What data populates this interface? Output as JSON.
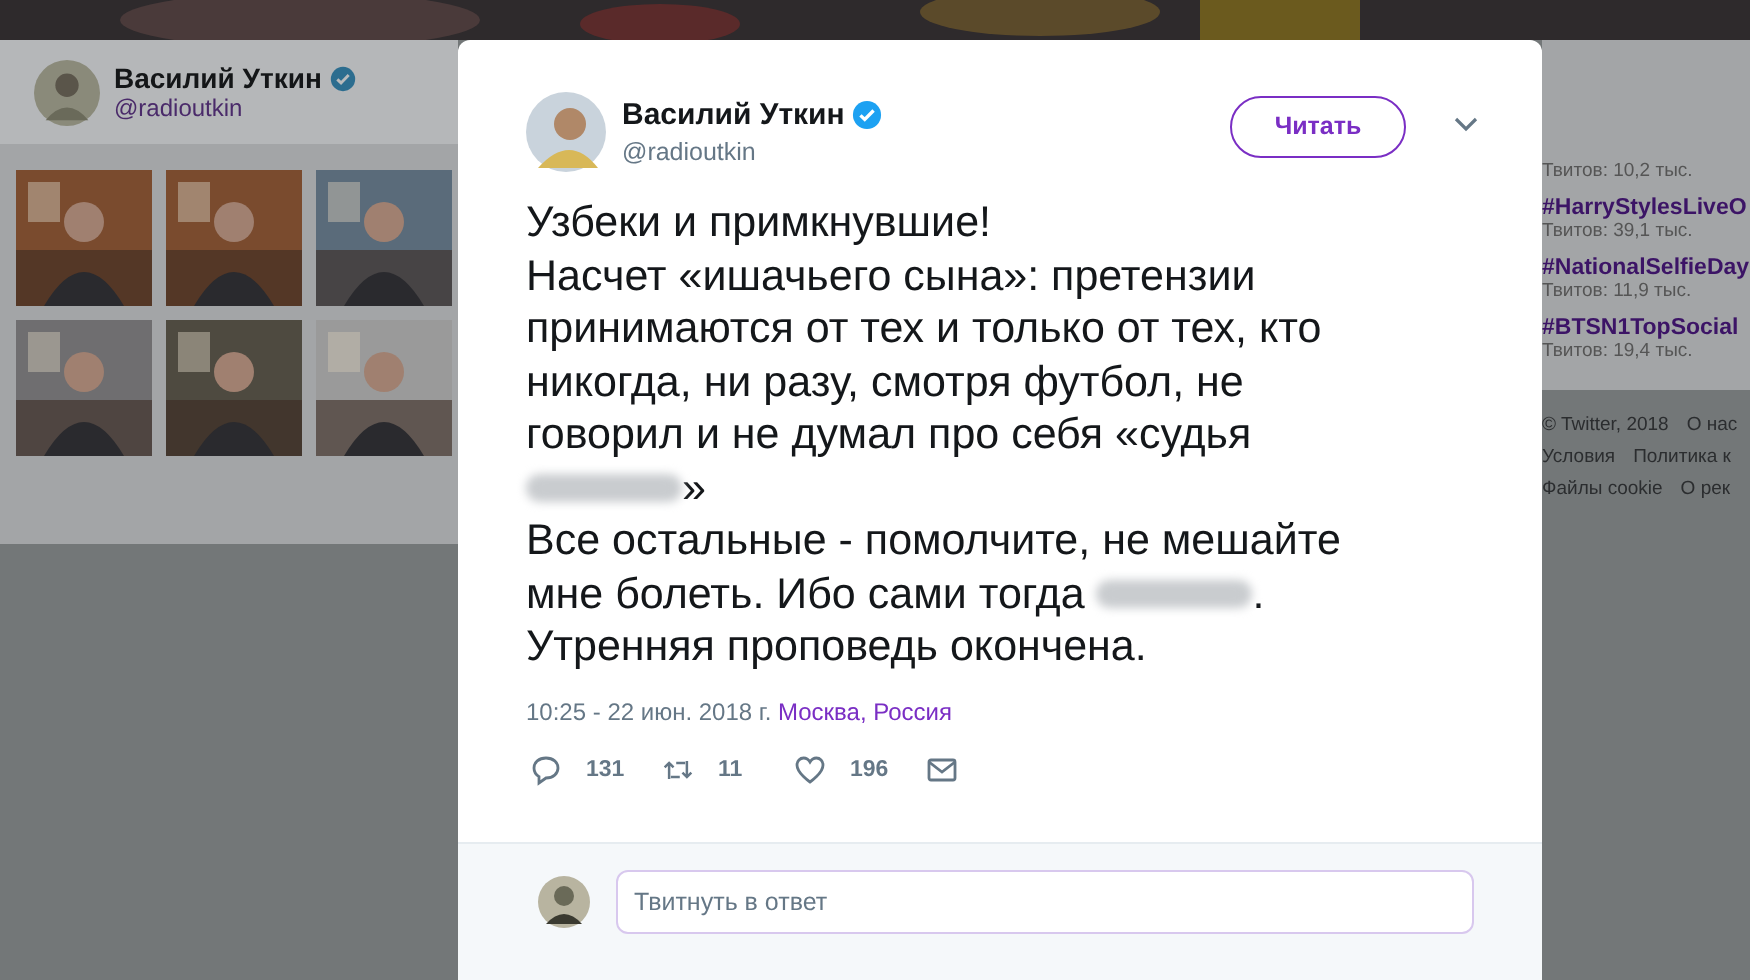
{
  "profile": {
    "name": "Василий Уткин",
    "handle": "@radioutkin",
    "verified": true
  },
  "media_grid": [
    {
      "kind": "picture"
    },
    {
      "kind": "picture"
    },
    {
      "kind": "picture"
    },
    {
      "kind": "picture"
    },
    {
      "kind": "picture"
    },
    {
      "kind": "picture"
    }
  ],
  "trends": [
    {
      "count": "Твитов: 10,2 тыс."
    },
    {
      "hashtag": "#HarryStylesLiveO",
      "count": "Твитов: 39,1 тыс."
    },
    {
      "hashtag": "#NationalSelfieDay",
      "count": "Твитов: 11,9 тыс."
    },
    {
      "hashtag": "#BTSN1TopSocial",
      "count": "Твитов: 19,4 тыс."
    }
  ],
  "footer_links": [
    [
      "© Twitter, 2018",
      "О нас"
    ],
    [
      "Условия",
      "Политика к"
    ],
    [
      "Файлы cookie",
      "О рек"
    ]
  ],
  "tweet": {
    "author": {
      "name": "Василий Уткин",
      "handle": "@radioutkin",
      "verified": true
    },
    "follow_button": "Читать",
    "lines": [
      [
        {
          "kind": "text",
          "text": "Узбеки и примкнувшие!"
        }
      ],
      [
        {
          "kind": "text",
          "text": "Насчет «ишачьего сына»: претензии"
        }
      ],
      [
        {
          "kind": "text",
          "text": "принимаются от тех и только от тех, кто"
        }
      ],
      [
        {
          "kind": "text",
          "text": "никогда, ни разу, смотря футбол, не"
        }
      ],
      [
        {
          "kind": "text",
          "text": "говорил и не думал про себя «судья"
        }
      ],
      [
        {
          "kind": "blur"
        },
        {
          "kind": "text",
          "text": "»"
        }
      ],
      [
        {
          "kind": "text",
          "text": "Все остальные - помолчите, не мешайте"
        }
      ],
      [
        {
          "kind": "text",
          "text": "мне болеть. Ибо сами тогда "
        },
        {
          "kind": "blur"
        },
        {
          "kind": "text",
          "text": "."
        }
      ],
      [
        {
          "kind": "text",
          "text": "Утренняя проповедь окончена."
        }
      ]
    ],
    "timestamp": "10:25 - 22 июн. 2018 г.",
    "location": "Москва, Россия",
    "actions": [
      {
        "kind": "reply",
        "count": "131"
      },
      {
        "kind": "retweet",
        "count": "11"
      },
      {
        "kind": "like",
        "count": "196"
      },
      {
        "kind": "message"
      }
    ],
    "reply_placeholder": "Твитнуть в ответ"
  }
}
